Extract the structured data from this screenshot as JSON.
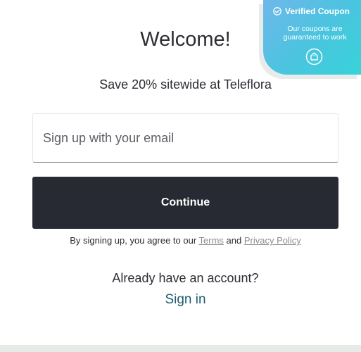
{
  "badge": {
    "title": "Verified Coupon",
    "subtitle": "Our coupons are guaranteed to work",
    "check_icon": "check-circle-icon",
    "tag_icon": "tag-icon",
    "gradient_colors": [
      "#6fb7ea",
      "#37d3d8"
    ]
  },
  "modal": {
    "title": "Welcome!",
    "subtitle": "Save 20% sitewide at Teleflora",
    "email": {
      "placeholder": "Sign up with your email",
      "value": ""
    },
    "continue_label": "Continue",
    "legal": {
      "prefix": "By signing up, you agree to our ",
      "terms_label": "Terms",
      "middle": " and ",
      "privacy_label": "Privacy Policy"
    },
    "account_question": "Already have an account?",
    "sign_in_label": "Sign in"
  },
  "colors": {
    "button_bg": "#282a33",
    "link": "#1f5b70",
    "footer_strip": "#e6ebe7"
  }
}
